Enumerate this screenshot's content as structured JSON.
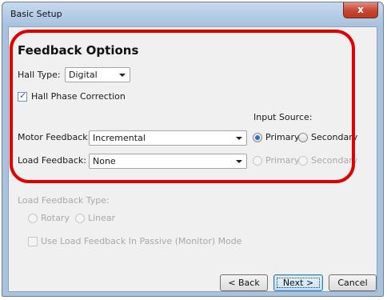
{
  "window": {
    "title": "Basic Setup",
    "close_symbol": "x"
  },
  "feedback": {
    "heading": "Feedback Options",
    "hall_type": {
      "label": "Hall Type:",
      "value": "Digital"
    },
    "hall_phase_correction": {
      "label": "Hall Phase Correction",
      "checked": true
    },
    "input_source_label": "Input Source:",
    "motor_feedback": {
      "label": "Motor Feedback:",
      "value": "Incremental",
      "primary": "Primary",
      "secondary": "Secondary",
      "selected": "Primary"
    },
    "load_feedback": {
      "label": "Load Feedback:",
      "value": "None",
      "primary": "Primary",
      "secondary": "Secondary",
      "radios_enabled": false
    }
  },
  "load_feedback_type": {
    "label": "Load Feedback Type:",
    "rotary": "Rotary",
    "linear": "Linear",
    "enabled": false
  },
  "passive_mode": {
    "label": "Use Load Feedback In Passive (Monitor) Mode",
    "checked": false,
    "enabled": false
  },
  "buttons": {
    "back": "< Back",
    "next": "Next >",
    "cancel": "Cancel"
  },
  "annotation": {
    "color": "#e00000"
  }
}
